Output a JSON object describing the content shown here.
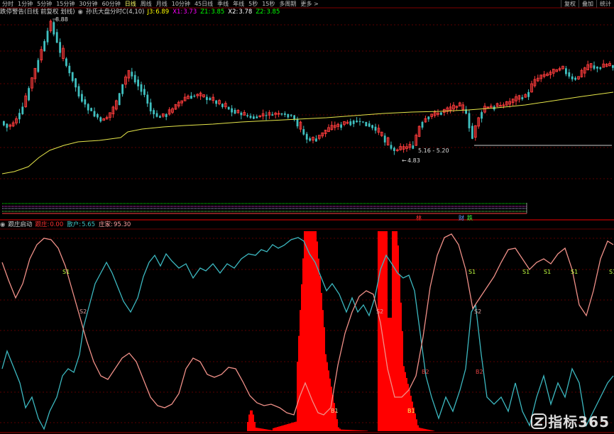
{
  "toolbar": {
    "periods": [
      "分时",
      "1分钟",
      "5分钟",
      "15分钟",
      "30分钟",
      "60分钟",
      "日线",
      "周线",
      "月线",
      "10分钟",
      "45日线",
      "季线",
      "年线",
      "5秒",
      "15秒",
      "多周期",
      "更多 >"
    ],
    "active_index": 6,
    "right_buttons": [
      "复权",
      "叠加",
      "统计"
    ]
  },
  "top_panel": {
    "indicator_name": "跌停警告(日线 前复权 划线)",
    "formula_name": "孙氏大盘分时C(4,10)",
    "values": [
      {
        "label": "J3:",
        "value": "6.89",
        "color": "#ffff00"
      },
      {
        "label": "X1:",
        "value": "3.73",
        "color": "#ff00ff"
      },
      {
        "label": "Z1:",
        "value": "3.85",
        "color": "#00ff00"
      },
      {
        "label": "X2:",
        "value": "3.78",
        "color": "#ffffff"
      },
      {
        "label": "Z2:",
        "value": "3.85",
        "color": "#00ff00"
      }
    ],
    "high_label": "8.88",
    "low_label": "4.83",
    "range_label": "5.16 - 5.20",
    "signal_left": "林",
    "signal_mid": "财",
    "signal_right": "跌"
  },
  "bottom_panel": {
    "indicator_name": "跟庄启动",
    "values": [
      {
        "label": "跟庄:",
        "value": "0.00",
        "color": "#ff3030"
      },
      {
        "label": "散户:",
        "value": "5.65",
        "color": "#40c0c0"
      },
      {
        "label": "庄家:",
        "value": "95.30",
        "color": "#ffa0a0"
      }
    ],
    "markers": [
      "S1",
      "S2",
      "B1",
      "B2"
    ]
  },
  "colors": {
    "up": "#ff3c3c",
    "down": "#40c0c0",
    "ma": "#e6e64a",
    "retail": "#3cb8c0",
    "dealer": "#f09088",
    "bar": "#ff0000"
  },
  "watermark": "指标365"
}
